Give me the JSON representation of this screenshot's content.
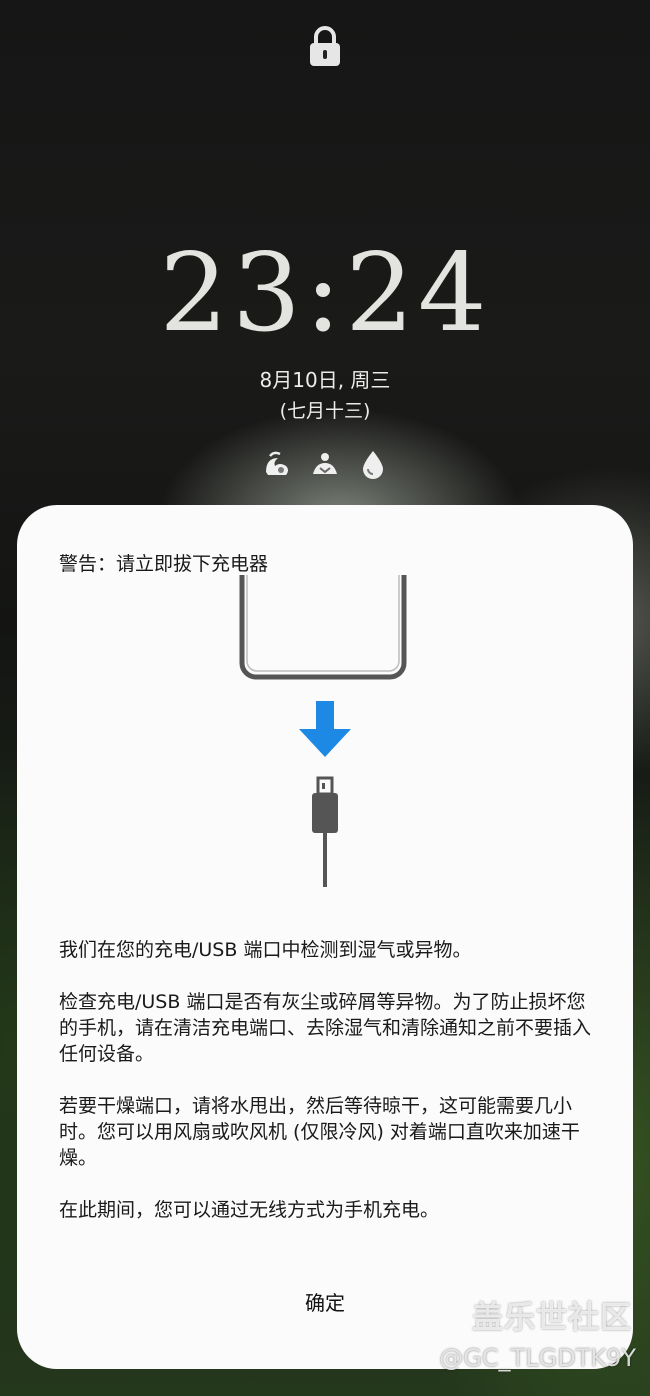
{
  "lockscreen": {
    "time": "23:24",
    "date": "8月10日, 周三",
    "lunar_date": "(七月十三)",
    "notification_icons": [
      "uc-browser-icon",
      "app-figure-icon",
      "drop-icon"
    ]
  },
  "dialog": {
    "title": "警告：请立即拔下充电器",
    "paragraphs": [
      "我们在您的充电/USB 端口中检测到湿气或异物。",
      "检查充电/USB 端口是否有灰尘或碎屑等异物。为了防止损坏您的手机，请在清洁充电端口、去除湿气和清除通知之前不要插入任何设备。",
      "若要干燥端口，请将水甩出，然后等待晾干，这可能需要几小时。您可以用风扇或吹风机 (仅限冷风) 对着端口直吹来加速干燥。",
      "在此期间，您可以通过无线方式为手机充电。"
    ],
    "confirm_label": "确定"
  },
  "watermark": {
    "site": "盖乐世社区",
    "user": "@GC_TLGDTK9Y"
  },
  "colors": {
    "arrow_blue": "#1e88e5",
    "dialog_bg": "#fbfbfb",
    "phone_outline": "#555555"
  }
}
